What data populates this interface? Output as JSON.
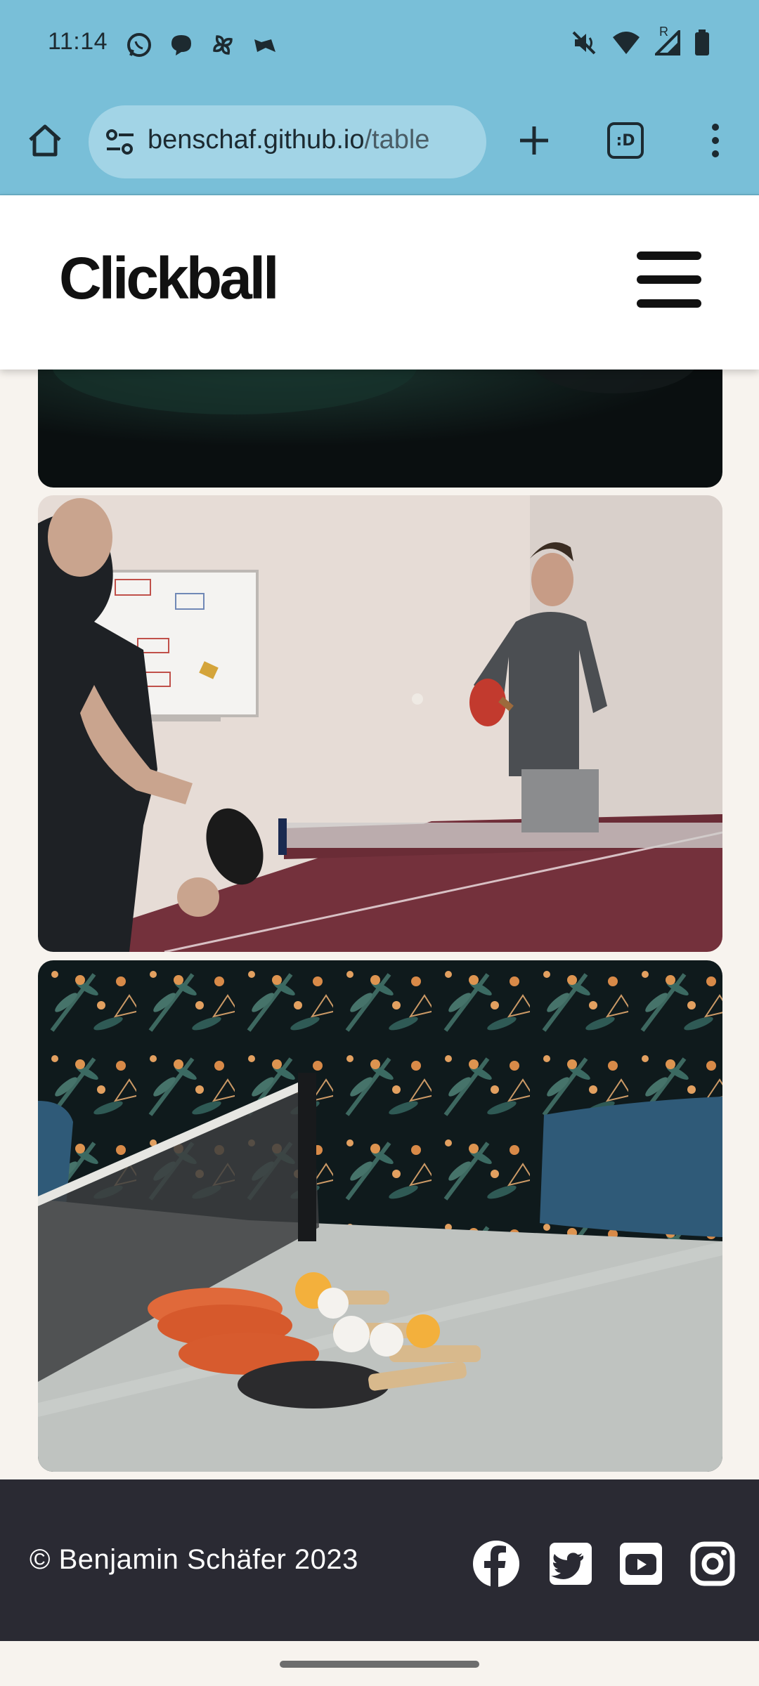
{
  "status_bar": {
    "time": "11:14",
    "left_icons": [
      "whatsapp-icon",
      "chat-bubble-icon",
      "pinwheel-icon",
      "bird-icon"
    ],
    "right_icons": [
      "mute-icon",
      "wifi-icon",
      "signal-roaming-icon",
      "battery-icon"
    ],
    "roaming_indicator": "R"
  },
  "browser": {
    "url_domain": "benschaf.github.io",
    "url_path": "/table",
    "tab_switcher_label": ":D"
  },
  "site": {
    "logo": "Clickball"
  },
  "gallery": {
    "images": [
      {
        "name": "dark-table-photo"
      },
      {
        "name": "office-ping-pong-photo"
      },
      {
        "name": "paddles-on-table-photo"
      }
    ]
  },
  "footer": {
    "copyright": "© Benjamin Schäfer 2023",
    "social": [
      "facebook-icon",
      "twitter-icon",
      "youtube-icon",
      "instagram-icon"
    ]
  },
  "colors": {
    "browser_chrome": "#79bfd8",
    "footer_bg": "#2a2a33",
    "header_bg": "#ffffff"
  }
}
